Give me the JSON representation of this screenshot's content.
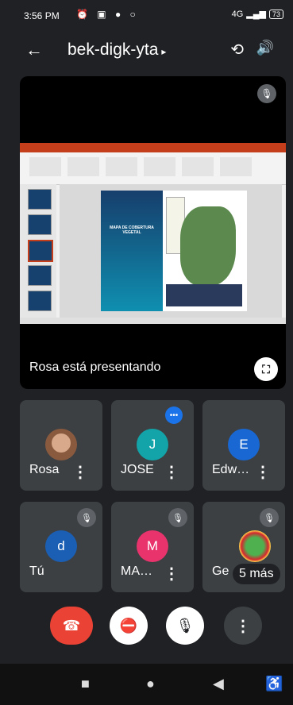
{
  "status_bar": {
    "time": "3:56 PM",
    "notification_icons": [
      "alarm-clock-icon",
      "app-icon",
      "location-icon",
      "circle-icon"
    ],
    "signal_label": "4G",
    "battery": "73"
  },
  "meeting": {
    "code": "bek-digk-yta",
    "caret": "▸"
  },
  "presentation": {
    "presenter_text": "Rosa está presentando",
    "slide_title": "MAPA DE COBERTURA VEGETAL"
  },
  "participants": [
    {
      "name": "Rosa",
      "initial": "",
      "avatar_color": "#8a5a3f",
      "muted": false,
      "speaking": false
    },
    {
      "name": "JOSE",
      "initial": "J",
      "avatar_color": "#12a4a8",
      "muted": false,
      "speaking": true
    },
    {
      "name": "Edw…",
      "initial": "E",
      "avatar_color": "#1967d2",
      "muted": false,
      "speaking": false
    },
    {
      "name": "Tú",
      "initial": "d",
      "avatar_color": "#1a5fb4",
      "muted": true,
      "speaking": false
    },
    {
      "name": "MA…",
      "initial": "M",
      "avatar_color": "#e8336d",
      "muted": true,
      "speaking": false
    },
    {
      "name": "Ge",
      "initial": "",
      "avatar_color": "#4fb04f",
      "muted": true,
      "speaking": false
    }
  ],
  "more_participants": "5 más",
  "icons": {
    "back": "←",
    "switch_camera": "⟲",
    "speaker": "🔊",
    "mic_off": "🎙",
    "fullscreen": "⛶",
    "dots": "⋮",
    "hangup": "☎",
    "camera_off": "⛔",
    "nav_home": "●",
    "nav_recent": "■",
    "nav_back": "◀",
    "nav_accessibility": "♿"
  }
}
